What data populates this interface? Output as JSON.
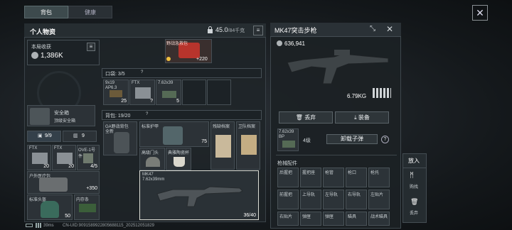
{
  "tabs": [
    {
      "label": "背包"
    },
    {
      "label": "健康"
    }
  ],
  "personal": {
    "title": "个人物资",
    "weight_current": "45.0",
    "weight_max": "/84千克",
    "haul_label": "本局收获",
    "haul_value": "1,386K",
    "first_aid_tag": "野战急救包",
    "first_aid_count": "+220",
    "pocket_label": "口袋: 3/5",
    "pocket_items": [
      {
        "name": "9x19",
        "sub": "AP6.3",
        "count": "25"
      },
      {
        "name": "FTX",
        "sub": "",
        "count": "?"
      },
      {
        "name": "7.62x39",
        "sub": "BP",
        "count": "5"
      }
    ],
    "safe_box_label": "安全箱",
    "safe_box_sub": "顶级安全箱",
    "cap_left": "9/9",
    "cap_right": "9",
    "backpack_label": "背包: 19/20",
    "backpack_items": [
      {
        "name": "GA野战背包",
        "sub": "全新"
      },
      {
        "name": "标准护甲",
        "sub": ""
      },
      {
        "name": "",
        "count": "75"
      },
      {
        "name": "残缺档案",
        "sub": ""
      },
      {
        "name": "卫队档案",
        "sub": ""
      },
      {
        "name": "高级门头",
        "sub": ""
      },
      {
        "name": "典雅陶瓷杯",
        "sub": ""
      }
    ],
    "gun_card": {
      "name": "MK47",
      "ammo": "7.62x39mm",
      "count": "36/40"
    },
    "safe_items": [
      {
        "name": "FTX",
        "count": "20"
      },
      {
        "name": "FTX",
        "count": "20"
      },
      {
        "name": "OVE-1号件",
        "count": "4/5"
      },
      {
        "name": "户外医疗包",
        "count": "+350"
      },
      {
        "name": "标准头盔",
        "count": ""
      },
      {
        "name": "内存条",
        "count": "50"
      }
    ]
  },
  "weapon": {
    "title": "MK47突击步枪",
    "price": "636,941",
    "weight": "6.79KG",
    "discard_label": "丢弃",
    "equip_label": "装备",
    "ammo_name": "7.62x39",
    "ammo_grade": "BP",
    "ammo_level": "4级",
    "unload_label": "卸载子弹",
    "attachments_title": "枪械配件",
    "attachments": [
      "后握把",
      "握把座",
      "枪管",
      "枪口",
      "枪托",
      "前握把",
      "上导轨",
      "左导轨",
      "右导轨",
      "左贴片",
      "右贴片",
      "弹匣",
      "弹匣",
      "瞄具",
      "战术瞄具"
    ]
  },
  "side": {
    "put_in": "放入",
    "mark_label": "购找",
    "discard_label": "丢弃"
  },
  "status": {
    "ping": "39ms",
    "uid": "CN-UID:9091589922805688115_202512051829"
  },
  "colors": {
    "accent": "#f0c040",
    "panel": "#1e2428",
    "highlight": "#e0e0d8"
  }
}
